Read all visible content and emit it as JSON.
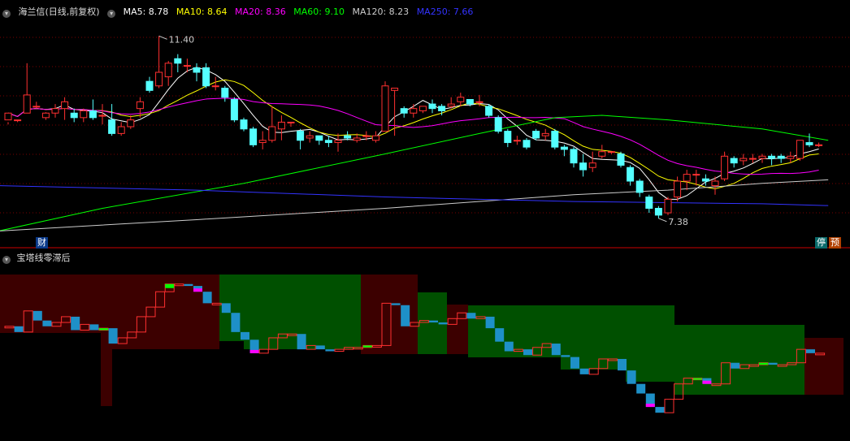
{
  "main_panel": {
    "security_title": "海兰信(日线,前复权)",
    "ma_labels": [
      {
        "text": "MA5: 8.78",
        "color": "#ffffff"
      },
      {
        "text": "MA10: 8.64",
        "color": "#ffff00"
      },
      {
        "text": "MA20: 8.36",
        "color": "#ff00ff"
      },
      {
        "text": "MA60: 9.10",
        "color": "#00ff00"
      },
      {
        "text": "MA120: 8.23",
        "color": "#cccccc"
      },
      {
        "text": "MA250: 7.66",
        "color": "#3333ff"
      }
    ],
    "high_marker": "11.40",
    "low_marker": "7.38",
    "badge_finance": "财",
    "badge_stop": "停",
    "badge_preview": "预"
  },
  "sub_panel": {
    "title": "宝塔线零滞后"
  },
  "colors": {
    "up": "#ff3030",
    "down": "#54ffff",
    "red_zone": "#3c0000",
    "green_zone": "#005000",
    "tower_up": "#ff3030",
    "tower_down": "#1e90c8",
    "tower_green": "#00ff00",
    "tower_magenta": "#ff00ff"
  },
  "chart_data": [
    {
      "type": "candlestick",
      "ylim": [
        7.0,
        11.8
      ],
      "candles": [
        [
          9.55,
          9.7,
          9.5,
          9.45
        ],
        [
          9.55,
          9.55,
          9.55,
          9.5
        ],
        [
          9.7,
          10.1,
          10.8,
          9.7
        ],
        [
          9.85,
          9.85,
          9.95,
          9.8
        ],
        [
          9.6,
          9.7,
          9.72,
          9.55
        ],
        [
          9.7,
          9.8,
          9.9,
          9.6
        ],
        [
          9.8,
          9.95,
          10.05,
          9.55
        ],
        [
          9.7,
          9.6,
          9.8,
          9.5
        ],
        [
          9.6,
          9.75,
          9.8,
          9.5
        ],
        [
          9.75,
          9.6,
          10.0,
          9.55
        ],
        [
          9.65,
          9.65,
          9.9,
          9.45
        ],
        [
          9.55,
          9.25,
          9.9,
          9.2
        ],
        [
          9.25,
          9.4,
          9.5,
          9.2
        ],
        [
          9.4,
          9.55,
          9.65,
          9.35
        ],
        [
          9.8,
          9.95,
          10.05,
          9.6
        ],
        [
          10.4,
          10.2,
          10.5,
          10.15
        ],
        [
          10.3,
          10.6,
          11.4,
          10.25
        ],
        [
          10.5,
          10.8,
          10.85,
          10.3
        ],
        [
          10.9,
          10.8,
          11.0,
          10.6
        ],
        [
          10.75,
          10.75,
          10.9,
          10.6
        ],
        [
          10.7,
          10.6,
          10.8,
          10.4
        ],
        [
          10.7,
          10.3,
          10.8,
          10.25
        ],
        [
          10.3,
          10.3,
          10.5,
          10.2
        ],
        [
          10.25,
          10.05,
          10.3,
          9.95
        ],
        [
          10.0,
          9.55,
          10.05,
          9.5
        ],
        [
          9.55,
          9.35,
          9.6,
          9.3
        ],
        [
          9.35,
          9.0,
          9.4,
          8.95
        ],
        [
          9.05,
          9.1,
          9.3,
          8.9
        ],
        [
          9.1,
          9.4,
          9.85,
          9.05
        ],
        [
          9.35,
          9.5,
          9.65,
          9.1
        ],
        [
          9.5,
          9.5,
          9.5,
          9.4
        ],
        [
          9.3,
          9.1,
          9.35,
          8.9
        ],
        [
          9.15,
          9.2,
          9.3,
          9.05
        ],
        [
          9.2,
          9.1,
          9.2,
          9.0
        ],
        [
          9.1,
          9.05,
          9.2,
          8.95
        ],
        [
          9.05,
          9.1,
          9.25,
          8.85
        ],
        [
          9.2,
          9.15,
          9.3,
          9.1
        ],
        [
          9.1,
          9.15,
          9.25,
          9.05
        ],
        [
          9.2,
          9.2,
          9.3,
          9.1
        ],
        [
          9.1,
          9.2,
          9.3,
          9.05
        ],
        [
          9.3,
          10.3,
          10.4,
          9.3
        ],
        [
          10.2,
          10.25,
          10.25,
          9.2
        ],
        [
          9.8,
          9.7,
          9.85,
          9.6
        ],
        [
          9.7,
          9.8,
          9.9,
          9.6
        ],
        [
          9.75,
          9.85,
          9.85,
          9.7
        ],
        [
          9.9,
          9.8,
          10.0,
          9.7
        ],
        [
          9.85,
          9.75,
          9.9,
          9.65
        ],
        [
          9.85,
          9.9,
          10.05,
          9.8
        ],
        [
          9.95,
          10.05,
          10.15,
          9.85
        ],
        [
          10.0,
          9.9,
          10.0,
          9.85
        ],
        [
          9.95,
          9.95,
          10.1,
          9.85
        ],
        [
          9.85,
          9.65,
          9.9,
          9.6
        ],
        [
          9.6,
          9.3,
          9.65,
          9.25
        ],
        [
          9.3,
          9.05,
          9.35,
          8.95
        ],
        [
          9.1,
          9.1,
          9.2,
          9.0
        ],
        [
          9.1,
          8.95,
          9.15,
          8.9
        ],
        [
          9.3,
          9.15,
          9.35,
          9.1
        ],
        [
          9.2,
          9.25,
          9.35,
          9.1
        ],
        [
          9.3,
          8.95,
          9.35,
          8.9
        ],
        [
          8.95,
          8.9,
          9.0,
          8.75
        ],
        [
          8.9,
          8.6,
          8.95,
          8.5
        ],
        [
          8.6,
          8.45,
          8.8,
          8.3
        ],
        [
          8.5,
          8.6,
          8.85,
          8.4
        ],
        [
          8.75,
          8.85,
          9.0,
          8.7
        ],
        [
          8.85,
          8.85,
          8.85,
          8.8
        ],
        [
          8.8,
          8.55,
          8.85,
          8.5
        ],
        [
          8.5,
          8.2,
          8.55,
          8.1
        ],
        [
          8.2,
          7.95,
          8.25,
          7.85
        ],
        [
          7.85,
          7.6,
          7.9,
          7.5
        ],
        [
          7.6,
          7.45,
          7.65,
          7.38
        ],
        [
          7.5,
          7.8,
          7.85,
          7.45
        ],
        [
          7.85,
          8.2,
          8.3,
          7.75
        ],
        [
          8.2,
          8.35,
          8.45,
          8.0
        ],
        [
          8.35,
          8.35,
          8.45,
          8.1
        ],
        [
          8.25,
          8.2,
          8.35,
          8.1
        ],
        [
          8.1,
          8.2,
          8.3,
          7.9
        ],
        [
          8.25,
          8.75,
          8.85,
          8.2
        ],
        [
          8.7,
          8.6,
          8.75,
          8.5
        ],
        [
          8.65,
          8.7,
          8.8,
          8.55
        ],
        [
          8.7,
          8.7,
          8.8,
          8.6
        ],
        [
          8.7,
          8.75,
          8.8,
          8.6
        ],
        [
          8.75,
          8.7,
          8.8,
          8.55
        ],
        [
          8.75,
          8.7,
          8.8,
          8.6
        ],
        [
          8.7,
          8.75,
          8.85,
          8.6
        ],
        [
          8.7,
          9.1,
          9.1,
          8.65
        ],
        [
          9.05,
          9.0,
          9.25,
          8.95
        ],
        [
          9.0,
          9.0,
          9.05,
          8.95
        ]
      ]
    },
    {
      "type": "tower",
      "ylim": [
        0,
        100
      ]
    }
  ]
}
